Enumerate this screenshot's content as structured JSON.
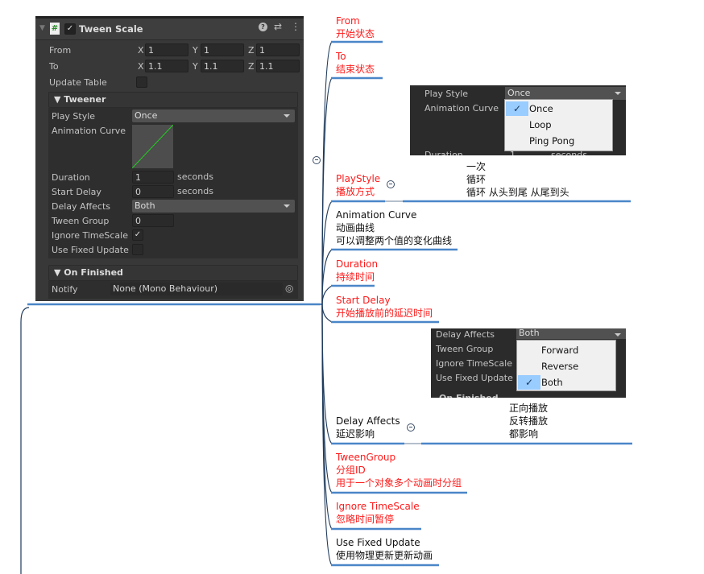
{
  "inspector": {
    "title": "Tween Scale",
    "from_label": "From",
    "to_label": "To",
    "axis_x": "X",
    "axis_y": "Y",
    "axis_z": "Z",
    "from": {
      "x": "1",
      "y": "1",
      "z": "1"
    },
    "to": {
      "x": "1.1",
      "y": "1.1",
      "z": "1.1"
    },
    "update_table_label": "Update Table",
    "update_table_checked": false,
    "tweener_section": "Tweener",
    "play_style_label": "Play Style",
    "play_style": "Once",
    "animation_curve_label": "Animation Curve",
    "duration_label": "Duration",
    "duration": "1",
    "seconds": "seconds",
    "start_delay_label": "Start Delay",
    "start_delay": "0",
    "delay_affects_label": "Delay Affects",
    "delay_affects": "Both",
    "tween_group_label": "Tween Group",
    "tween_group": "0",
    "ignore_timescale_label": "Ignore TimeScale",
    "ignore_timescale_checked": true,
    "use_fixed_update_label": "Use Fixed Update",
    "use_fixed_update_checked": false,
    "on_finished_section": "On Finished",
    "notify_label": "Notify",
    "notify": "None (Mono Behaviour)",
    "curve_color": "#22cc22"
  },
  "play_style_popup": {
    "label1": "Play Style",
    "value": "Once",
    "label2": "Animation Curve",
    "label3": "Duration",
    "label3_value": "1",
    "label3_unit": "seconds",
    "options": [
      "Once",
      "Loop",
      "Ping Pong"
    ],
    "selected": "Once",
    "notes": [
      "一次",
      "循环",
      "循环 从头到尾 从尾到头"
    ]
  },
  "delay_affects_popup": {
    "labels": [
      "Delay Affects",
      "Tween Group",
      "Ignore TimeScale",
      "Use Fixed Update"
    ],
    "value": "Both",
    "footer": "On Finished",
    "options": [
      "Forward",
      "Reverse",
      "Both"
    ],
    "selected": "Both",
    "notes": [
      "正向播放",
      "反转播放",
      "都影响"
    ]
  },
  "mindmap": {
    "line_color": "#4a86c8",
    "text_red": "#ff1a1a",
    "nodes": [
      {
        "title": "From",
        "lines": [
          "开始状态"
        ]
      },
      {
        "title": "To",
        "lines": [
          "结束状态"
        ]
      },
      {
        "title": "PlayStyle",
        "lines": [
          "播放方式"
        ]
      },
      {
        "title": "Animation Curve",
        "lines": [
          "动画曲线",
          "可以调整两个值的变化曲线"
        ]
      },
      {
        "title": "Duration",
        "lines": [
          "持续时间"
        ]
      },
      {
        "title": "Start Delay",
        "lines": [
          "开始播放前的延迟时间"
        ]
      },
      {
        "title": "Delay Affects",
        "lines": [
          "延迟影响"
        ]
      },
      {
        "title": "TweenGroup",
        "lines": [
          "分组ID",
          "用于一个对象多个动画时分组"
        ]
      },
      {
        "title": "Ignore TimeScale",
        "lines": [
          "忽略时间暂停"
        ]
      },
      {
        "title": "Use Fixed Update",
        "lines": [
          "使用物理更新更新动画"
        ]
      }
    ]
  }
}
